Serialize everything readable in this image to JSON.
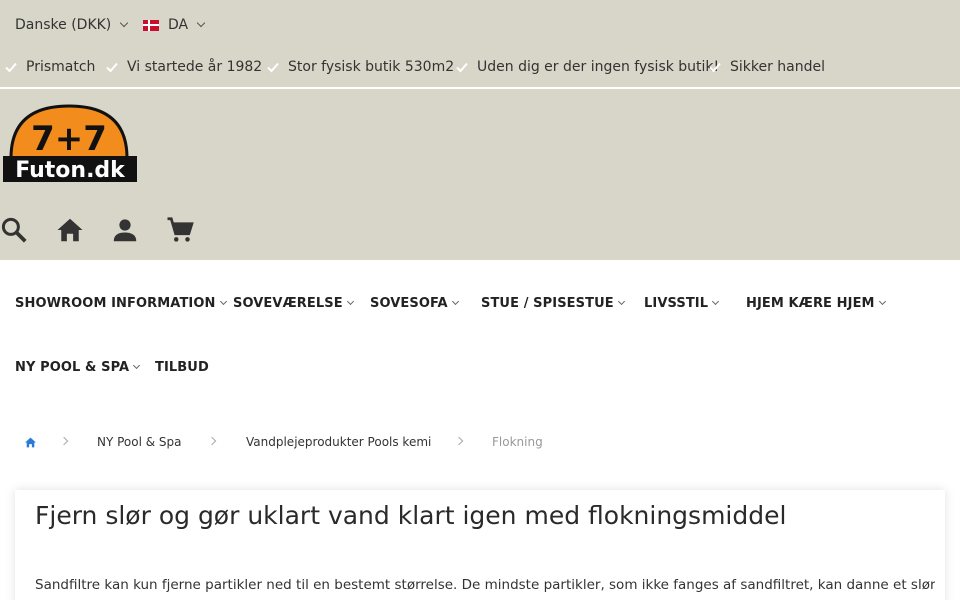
{
  "header": {
    "currency": "Danske (DKK)",
    "language": "DA"
  },
  "usps": [
    "Prismatch",
    "Vi startede år 1982",
    "Stor fysisk butik 530m2",
    "Uden dig er der ingen fysisk butik!",
    "Sikker handel"
  ],
  "logo": {
    "line1": "7+7",
    "line2": "Futon.dk"
  },
  "icons": [
    "search-icon",
    "home-icon",
    "account-icon",
    "cart-icon"
  ],
  "nav": [
    {
      "label": "SHOWROOM INFORMATION",
      "dropdown": true
    },
    {
      "label": "SOVEVÆRELSE",
      "dropdown": true
    },
    {
      "label": "SOVESOFA",
      "dropdown": true
    },
    {
      "label": "STUE / SPISESTUE",
      "dropdown": true
    },
    {
      "label": "LIVSSTIL",
      "dropdown": true
    },
    {
      "label": "HJEM KÆRE HJEM",
      "dropdown": true
    },
    {
      "label": "NY POOL & SPA",
      "dropdown": true
    },
    {
      "label": "TILBUD",
      "dropdown": false
    }
  ],
  "breadcrumb": [
    "NY Pool & Spa",
    "Vandplejeprodukter Pools kemi",
    "Flokning"
  ],
  "content": {
    "title": "Fjern slør og gør uklart vand klart igen med flokningsmiddel",
    "paragraph": "Sandfiltre kan kun fjerne partikler ned til en bestemt størrelse. De mindste partikler, som ikke fanges af sandfiltret, kan danne et slør i vandet,"
  },
  "colors": {
    "header_bg": "#d8d6c8",
    "logo_orange": "#f28c1c",
    "check_white": "#ffffff",
    "home_blue": "#2b7bd6"
  }
}
